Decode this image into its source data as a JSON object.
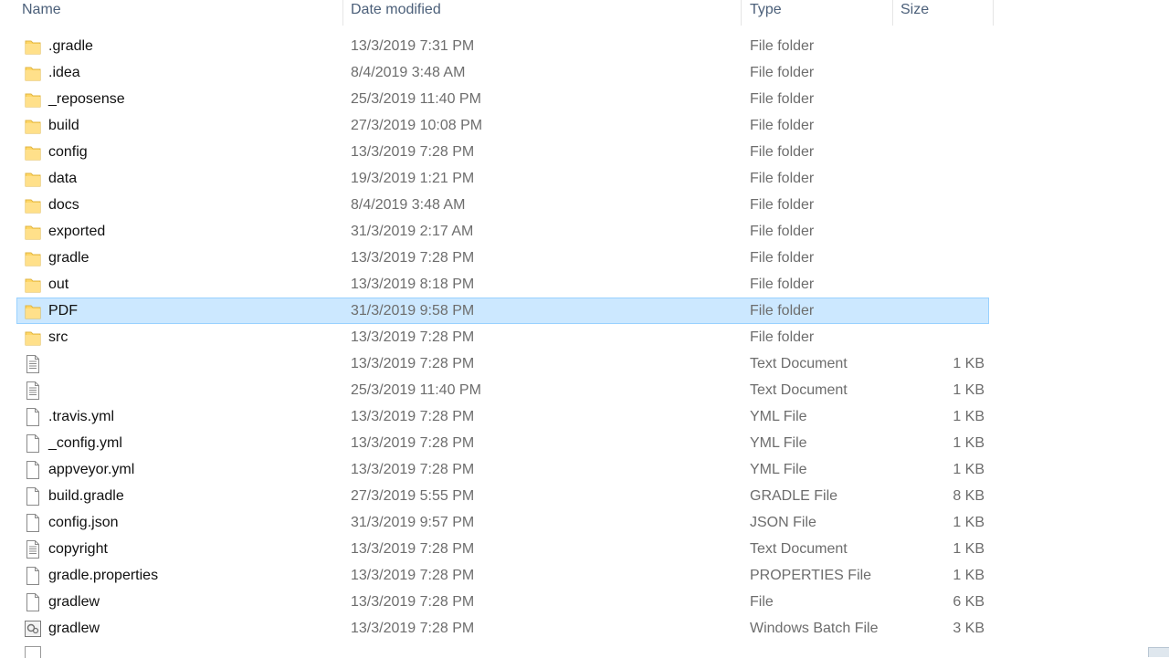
{
  "columns": {
    "name": "Name",
    "date": "Date modified",
    "type": "Type",
    "size": "Size"
  },
  "selected_index": 10,
  "rows": [
    {
      "name": ".gradle",
      "date": "13/3/2019 7:31 PM",
      "type": "File folder",
      "size": "",
      "icon": "folder-icon"
    },
    {
      "name": ".idea",
      "date": "8/4/2019 3:48 AM",
      "type": "File folder",
      "size": "",
      "icon": "folder-icon"
    },
    {
      "name": "_reposense",
      "date": "25/3/2019 11:40 PM",
      "type": "File folder",
      "size": "",
      "icon": "folder-icon"
    },
    {
      "name": "build",
      "date": "27/3/2019 10:08 PM",
      "type": "File folder",
      "size": "",
      "icon": "folder-icon"
    },
    {
      "name": "config",
      "date": "13/3/2019 7:28 PM",
      "type": "File folder",
      "size": "",
      "icon": "folder-icon"
    },
    {
      "name": "data",
      "date": "19/3/2019 1:21 PM",
      "type": "File folder",
      "size": "",
      "icon": "folder-icon"
    },
    {
      "name": "docs",
      "date": "8/4/2019 3:48 AM",
      "type": "File folder",
      "size": "",
      "icon": "folder-icon"
    },
    {
      "name": "exported",
      "date": "31/3/2019 2:17 AM",
      "type": "File folder",
      "size": "",
      "icon": "folder-icon"
    },
    {
      "name": "gradle",
      "date": "13/3/2019 7:28 PM",
      "type": "File folder",
      "size": "",
      "icon": "folder-icon"
    },
    {
      "name": "out",
      "date": "13/3/2019 8:18 PM",
      "type": "File folder",
      "size": "",
      "icon": "folder-icon"
    },
    {
      "name": "PDF",
      "date": "31/3/2019 9:58 PM",
      "type": "File folder",
      "size": "",
      "icon": "folder-icon"
    },
    {
      "name": "src",
      "date": "13/3/2019 7:28 PM",
      "type": "File folder",
      "size": "",
      "icon": "folder-icon"
    },
    {
      "name": "",
      "date": "13/3/2019 7:28 PM",
      "type": "Text Document",
      "size": "1 KB",
      "icon": "text-document-icon"
    },
    {
      "name": "",
      "date": "25/3/2019 11:40 PM",
      "type": "Text Document",
      "size": "1 KB",
      "icon": "text-document-icon"
    },
    {
      "name": ".travis.yml",
      "date": "13/3/2019 7:28 PM",
      "type": "YML File",
      "size": "1 KB",
      "icon": "file-icon"
    },
    {
      "name": "_config.yml",
      "date": "13/3/2019 7:28 PM",
      "type": "YML File",
      "size": "1 KB",
      "icon": "file-icon"
    },
    {
      "name": "appveyor.yml",
      "date": "13/3/2019 7:28 PM",
      "type": "YML File",
      "size": "1 KB",
      "icon": "file-icon"
    },
    {
      "name": "build.gradle",
      "date": "27/3/2019 5:55 PM",
      "type": "GRADLE File",
      "size": "8 KB",
      "icon": "file-icon"
    },
    {
      "name": "config.json",
      "date": "31/3/2019 9:57 PM",
      "type": "JSON File",
      "size": "1 KB",
      "icon": "file-icon"
    },
    {
      "name": "copyright",
      "date": "13/3/2019 7:28 PM",
      "type": "Text Document",
      "size": "1 KB",
      "icon": "text-document-icon"
    },
    {
      "name": "gradle.properties",
      "date": "13/3/2019 7:28 PM",
      "type": "PROPERTIES File",
      "size": "1 KB",
      "icon": "file-icon"
    },
    {
      "name": "gradlew",
      "date": "13/3/2019 7:28 PM",
      "type": "File",
      "size": "6 KB",
      "icon": "file-icon"
    },
    {
      "name": "gradlew",
      "date": "13/3/2019 7:28 PM",
      "type": "Windows Batch File",
      "size": "3 KB",
      "icon": "batch-file-icon"
    }
  ],
  "colors": {
    "selection_bg": "#cce8ff",
    "selection_border": "#99d1ff",
    "folder": "#ffd766",
    "header_text": "#4c607a"
  }
}
